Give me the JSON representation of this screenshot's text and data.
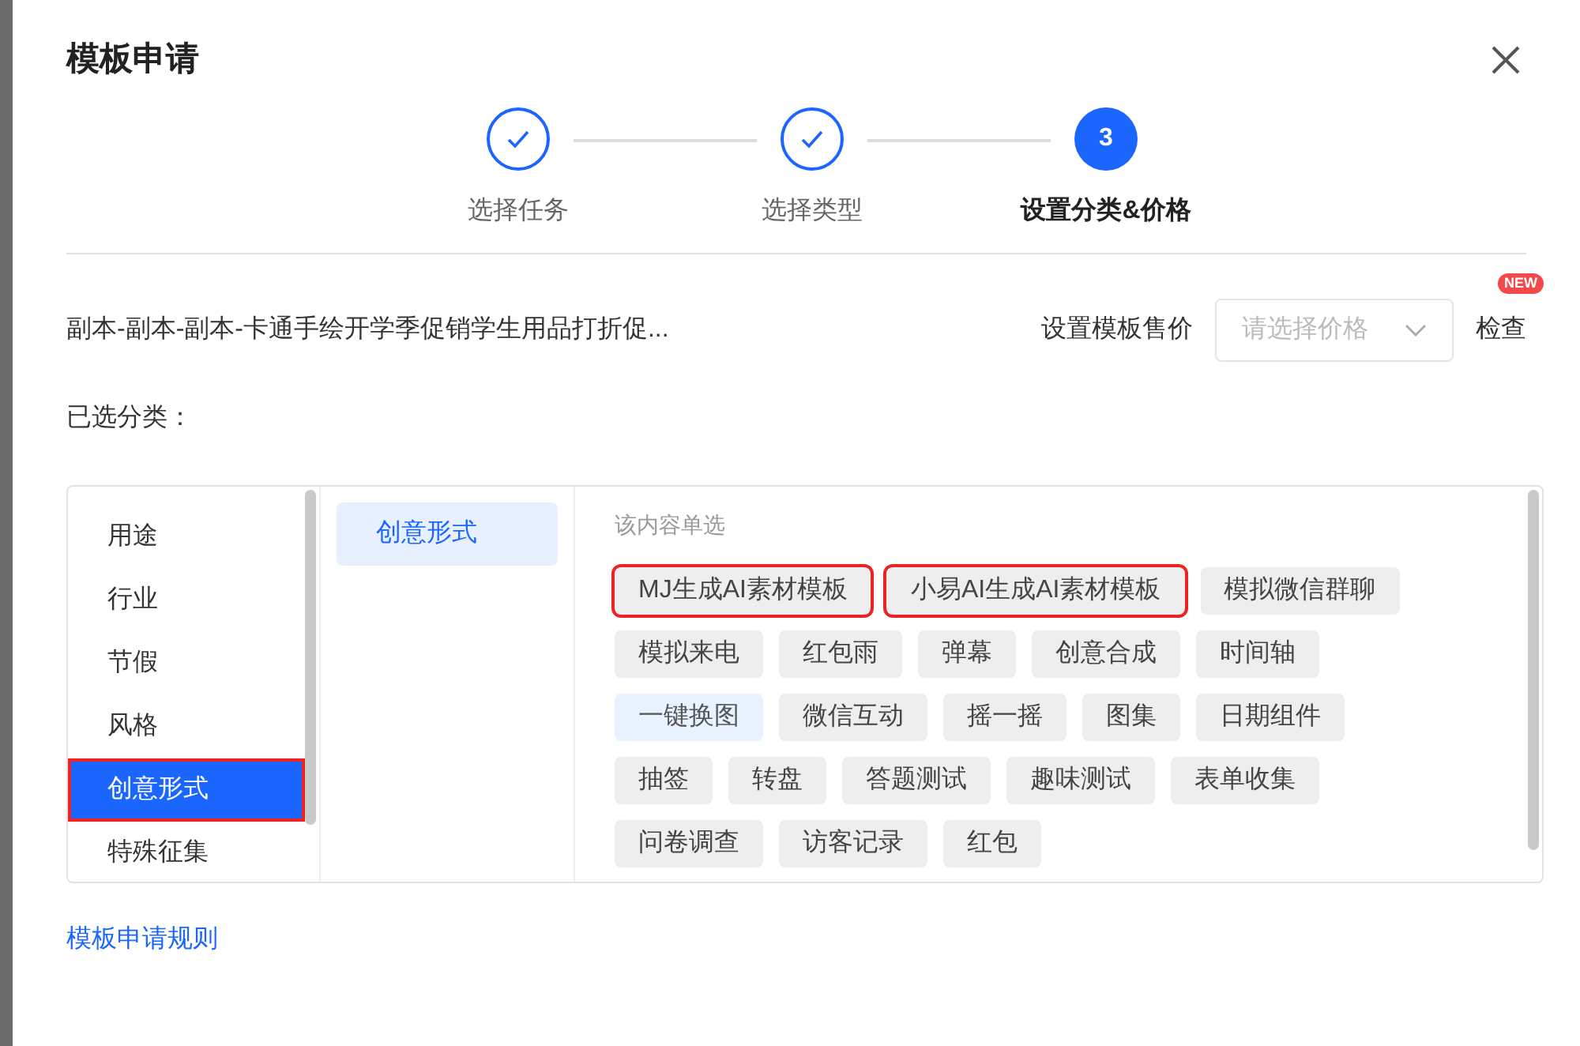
{
  "dialog": {
    "title": "模板申请"
  },
  "steps": [
    {
      "label": "选择任务",
      "completed": true
    },
    {
      "label": "选择类型",
      "completed": true
    },
    {
      "label": "设置分类&价格",
      "completed": false,
      "number": "3"
    }
  ],
  "template_name": "副本-副本-副本-卡通手绘开学季促销学生用品打折促...",
  "price": {
    "label": "设置模板售价",
    "placeholder": "请选择价格"
  },
  "check": {
    "label": "检查",
    "badge": "NEW"
  },
  "selected_label": "已选分类：",
  "categories": [
    {
      "label": "用途",
      "selected": false,
      "highlighted": false
    },
    {
      "label": "行业",
      "selected": false,
      "highlighted": false
    },
    {
      "label": "节假",
      "selected": false,
      "highlighted": false
    },
    {
      "label": "风格",
      "selected": false,
      "highlighted": false
    },
    {
      "label": "创意形式",
      "selected": true,
      "highlighted": true
    },
    {
      "label": "特殊征集",
      "selected": false,
      "highlighted": false
    }
  ],
  "subcategories": [
    {
      "label": "创意形式",
      "selected": true
    }
  ],
  "hint": "该内容单选",
  "tags": [
    {
      "label": "MJ生成AI素材模板",
      "selected": false,
      "highlighted": true
    },
    {
      "label": "小易AI生成AI素材模板",
      "selected": false,
      "highlighted": true
    },
    {
      "label": "模拟微信群聊",
      "selected": false,
      "highlighted": false
    },
    {
      "label": "模拟来电",
      "selected": false,
      "highlighted": false
    },
    {
      "label": "红包雨",
      "selected": false,
      "highlighted": false
    },
    {
      "label": "弹幕",
      "selected": false,
      "highlighted": false
    },
    {
      "label": "创意合成",
      "selected": false,
      "highlighted": false
    },
    {
      "label": "时间轴",
      "selected": false,
      "highlighted": false
    },
    {
      "label": "一键换图",
      "selected": true,
      "highlighted": false
    },
    {
      "label": "微信互动",
      "selected": false,
      "highlighted": false
    },
    {
      "label": "摇一摇",
      "selected": false,
      "highlighted": false
    },
    {
      "label": "图集",
      "selected": false,
      "highlighted": false
    },
    {
      "label": "日期组件",
      "selected": false,
      "highlighted": false
    },
    {
      "label": "抽签",
      "selected": false,
      "highlighted": false
    },
    {
      "label": "转盘",
      "selected": false,
      "highlighted": false
    },
    {
      "label": "答题测试",
      "selected": false,
      "highlighted": false
    },
    {
      "label": "趣味测试",
      "selected": false,
      "highlighted": false
    },
    {
      "label": "表单收集",
      "selected": false,
      "highlighted": false
    },
    {
      "label": "问卷调查",
      "selected": false,
      "highlighted": false
    },
    {
      "label": "访客记录",
      "selected": false,
      "highlighted": false
    },
    {
      "label": "红包",
      "selected": false,
      "highlighted": false
    }
  ],
  "rules_link": "模板申请规则"
}
